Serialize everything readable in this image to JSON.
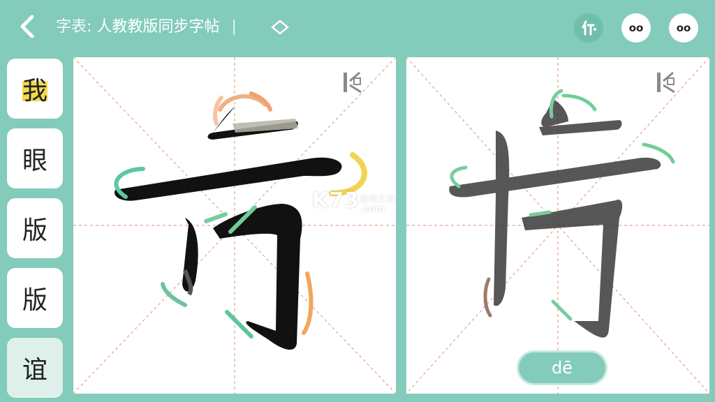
{
  "header": {
    "title_prefix": "字表",
    "title_text": "人教教版同步字帖",
    "tool_a_label": "oo",
    "tool_b_label": "oo"
  },
  "sidebar": {
    "items": [
      {
        "label": "我"
      },
      {
        "label": "眼"
      },
      {
        "label": "版"
      },
      {
        "label": "版"
      },
      {
        "label": "谊"
      }
    ]
  },
  "right_panel": {
    "pinyin": "dē"
  },
  "watermark": {
    "main": "K73",
    "sub": "游戏之家",
    "domain": ".com"
  },
  "colors": {
    "background": "#83cbbb",
    "accent": "#6fbfab",
    "highlight": "#f1d94a"
  }
}
